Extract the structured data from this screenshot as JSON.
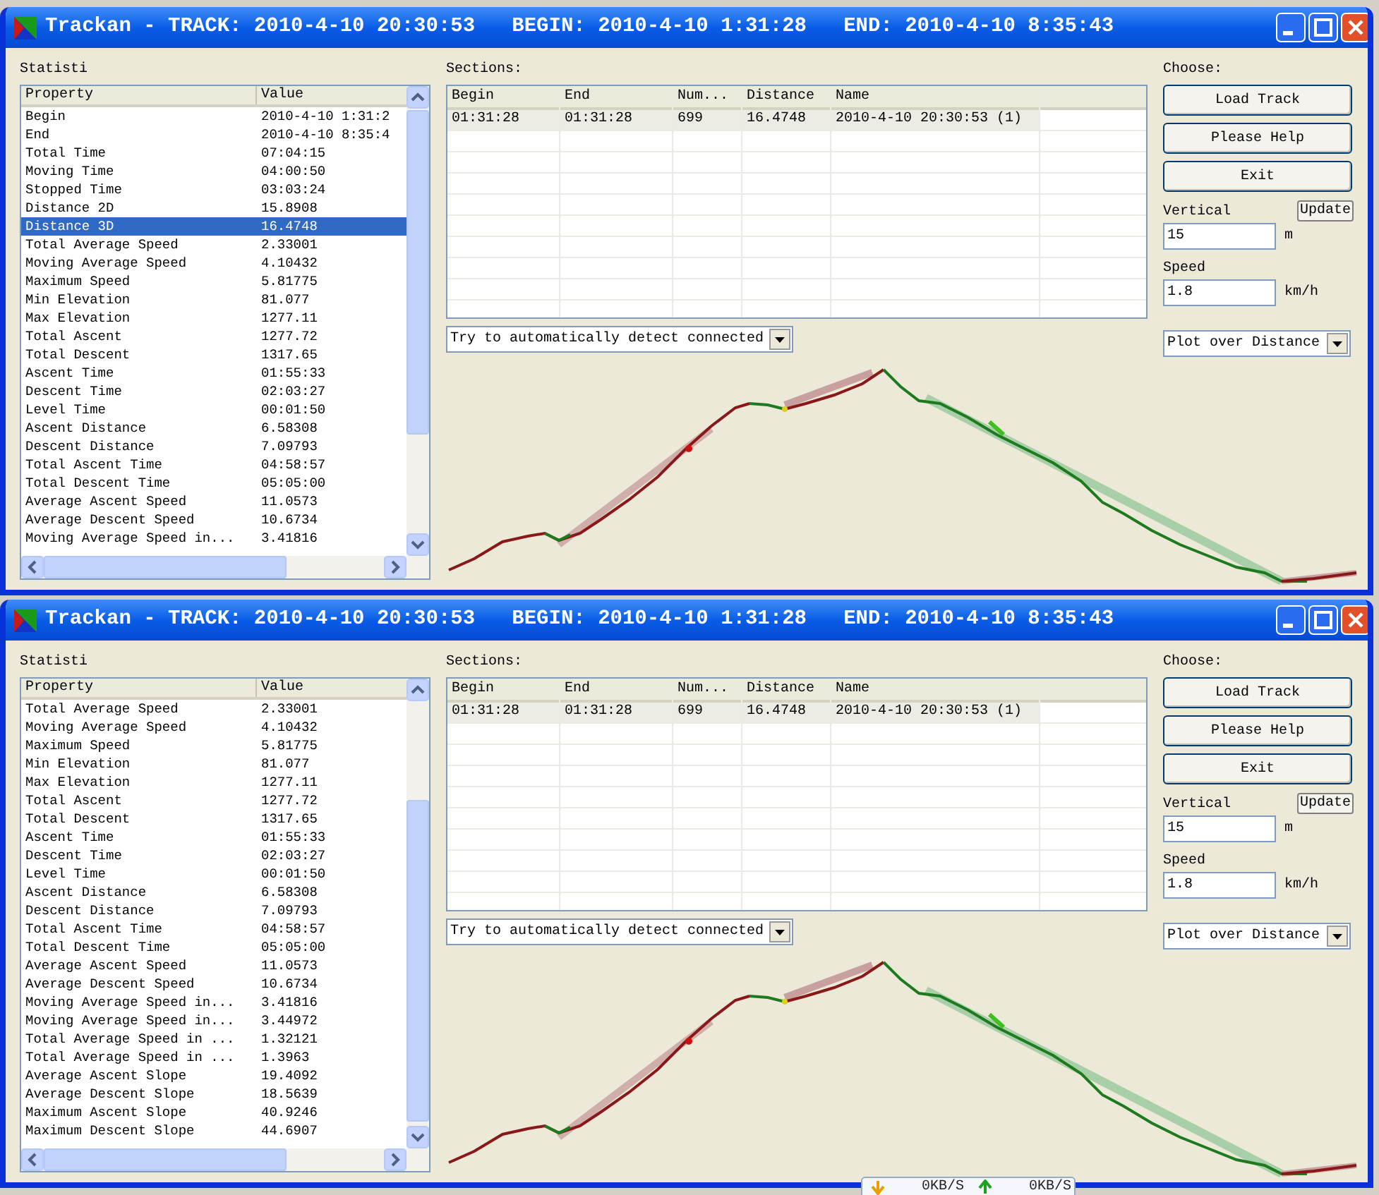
{
  "windows": [
    {
      "title": "Trackan - TRACK: 2010-4-10 20:30:53   BEGIN: 2010-4-10 1:31:28   END: 2010-4-10 8:35:43",
      "statistics": {
        "label": "Statisti",
        "columns": [
          "Property",
          "Value"
        ],
        "rows": [
          {
            "property": "Begin",
            "value": "2010-4-10 1:31:2",
            "selected": false
          },
          {
            "property": "End",
            "value": "2010-4-10 8:35:4",
            "selected": false
          },
          {
            "property": "Total Time",
            "value": "07:04:15",
            "selected": false
          },
          {
            "property": "Moving Time",
            "value": "04:00:50",
            "selected": false
          },
          {
            "property": "Stopped Time",
            "value": "03:03:24",
            "selected": false
          },
          {
            "property": "Distance 2D",
            "value": "15.8908",
            "selected": false
          },
          {
            "property": "Distance 3D",
            "value": "16.4748",
            "selected": true
          },
          {
            "property": "Total Average Speed",
            "value": "2.33001",
            "selected": false
          },
          {
            "property": "Moving Average Speed",
            "value": "4.10432",
            "selected": false
          },
          {
            "property": "Maximum Speed",
            "value": "5.81775",
            "selected": false
          },
          {
            "property": "Min Elevation",
            "value": "81.077",
            "selected": false
          },
          {
            "property": "Max Elevation",
            "value": "1277.11",
            "selected": false
          },
          {
            "property": "Total Ascent",
            "value": "1277.72",
            "selected": false
          },
          {
            "property": "Total Descent",
            "value": "1317.65",
            "selected": false
          },
          {
            "property": "Ascent Time",
            "value": "01:55:33",
            "selected": false
          },
          {
            "property": "Descent Time",
            "value": "02:03:27",
            "selected": false
          },
          {
            "property": "Level Time",
            "value": "00:01:50",
            "selected": false
          },
          {
            "property": "Ascent Distance",
            "value": "6.58308",
            "selected": false
          },
          {
            "property": "Descent Distance",
            "value": "7.09793",
            "selected": false
          },
          {
            "property": "Total Ascent Time",
            "value": "04:58:57",
            "selected": false
          },
          {
            "property": "Total Descent Time",
            "value": "05:05:00",
            "selected": false
          },
          {
            "property": "Average Ascent Speed",
            "value": "11.0573",
            "selected": false
          },
          {
            "property": "Average Descent Speed",
            "value": "10.6734",
            "selected": false
          },
          {
            "property": "Moving Average Speed in...",
            "value": "3.41816",
            "selected": false
          }
        ]
      },
      "sections": {
        "label": "Sections:",
        "columns": [
          "Begin",
          "End",
          "Num...",
          "Distance",
          "Name"
        ],
        "rows": [
          {
            "cells": [
              "01:31:28",
              "01:31:28",
              "699",
              "16.4748",
              "2010-4-10 20:30:53 (1)"
            ],
            "selected": true
          }
        ],
        "detect": "Try to automatically detect connected"
      },
      "choose": {
        "label": "Choose:",
        "buttons": [
          "Load Track",
          "Please Help",
          "Exit"
        ],
        "vertical": {
          "label": "Vertical",
          "value": "15",
          "unit": "m",
          "button": "Update"
        },
        "speed": {
          "label": "Speed",
          "value": "1.8",
          "unit": "km/h"
        },
        "plot": "Plot over Distance"
      }
    },
    {
      "title": "Trackan - TRACK: 2010-4-10 20:30:53   BEGIN: 2010-4-10 1:31:28   END: 2010-4-10 8:35:43",
      "statistics": {
        "label": "Statisti",
        "columns": [
          "Property",
          "Value"
        ],
        "rows": [
          {
            "property": "Total Average Speed",
            "value": "2.33001",
            "selected": false
          },
          {
            "property": "Moving Average Speed",
            "value": "4.10432",
            "selected": false
          },
          {
            "property": "Maximum Speed",
            "value": "5.81775",
            "selected": false
          },
          {
            "property": "Min Elevation",
            "value": "81.077",
            "selected": false
          },
          {
            "property": "Max Elevation",
            "value": "1277.11",
            "selected": false
          },
          {
            "property": "Total Ascent",
            "value": "1277.72",
            "selected": false
          },
          {
            "property": "Total Descent",
            "value": "1317.65",
            "selected": false
          },
          {
            "property": "Ascent Time",
            "value": "01:55:33",
            "selected": false
          },
          {
            "property": "Descent Time",
            "value": "02:03:27",
            "selected": false
          },
          {
            "property": "Level Time",
            "value": "00:01:50",
            "selected": false
          },
          {
            "property": "Ascent Distance",
            "value": "6.58308",
            "selected": false
          },
          {
            "property": "Descent Distance",
            "value": "7.09793",
            "selected": false
          },
          {
            "property": "Total Ascent Time",
            "value": "04:58:57",
            "selected": false
          },
          {
            "property": "Total Descent Time",
            "value": "05:05:00",
            "selected": false
          },
          {
            "property": "Average Ascent Speed",
            "value": "11.0573",
            "selected": false
          },
          {
            "property": "Average Descent Speed",
            "value": "10.6734",
            "selected": false
          },
          {
            "property": "Moving Average Speed in...",
            "value": "3.41816",
            "selected": false
          },
          {
            "property": "Moving Average Speed in...",
            "value": "3.44972",
            "selected": false
          },
          {
            "property": "Total Average Speed in ...",
            "value": "1.32121",
            "selected": false
          },
          {
            "property": "Total Average Speed in ...",
            "value": "1.3963",
            "selected": false
          },
          {
            "property": "Average Ascent Slope",
            "value": "19.4092",
            "selected": false
          },
          {
            "property": "Average Descent Slope",
            "value": "18.5639",
            "selected": false
          },
          {
            "property": "Maximum Ascent Slope",
            "value": "40.9246",
            "selected": false
          },
          {
            "property": "Maximum Descent Slope",
            "value": "44.6907",
            "selected": false
          }
        ]
      },
      "sections": {
        "label": "Sections:",
        "columns": [
          "Begin",
          "End",
          "Num...",
          "Distance",
          "Name"
        ],
        "rows": [
          {
            "cells": [
              "01:31:28",
              "01:31:28",
              "699",
              "16.4748",
              "2010-4-10 20:30:53 (1)"
            ],
            "selected": true
          }
        ],
        "detect": "Try to automatically detect connected"
      },
      "choose": {
        "label": "Choose:",
        "buttons": [
          "Load Track",
          "Please Help",
          "Exit"
        ],
        "vertical": {
          "label": "Vertical",
          "value": "15",
          "unit": "m",
          "button": "Update"
        },
        "speed": {
          "label": "Speed",
          "value": "1.8",
          "unit": "km/h"
        },
        "plot": "Plot over Distance"
      }
    }
  ],
  "network_tooltip": {
    "down": "0KB/S",
    "up": "0KB/S"
  }
}
